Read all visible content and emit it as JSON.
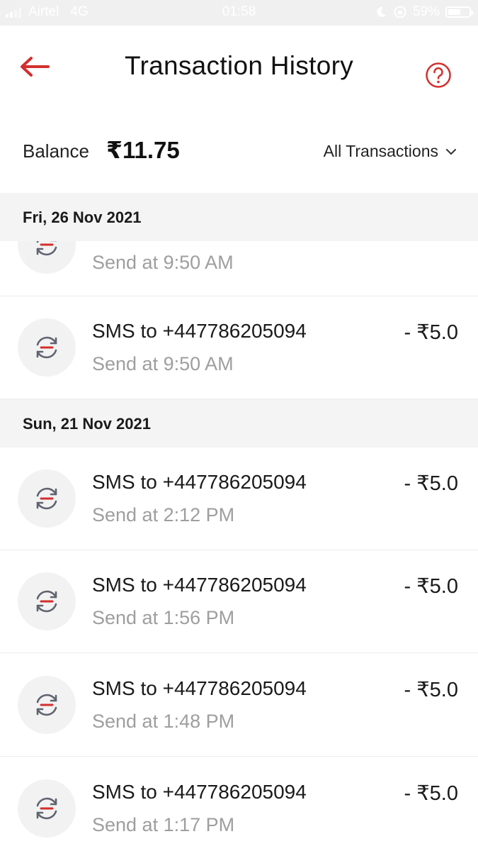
{
  "status_bar": {
    "carrier": "Airtel",
    "network": "4G",
    "time": "01:58",
    "battery_percent": "59%",
    "battery_level": 0.59,
    "icons": [
      "moon-icon",
      "orientation-lock-icon"
    ]
  },
  "header": {
    "title": "Transaction History",
    "back_icon": "arrow-left-icon",
    "help_icon": "question-circle-icon",
    "accent_color": "#d32f2f"
  },
  "balance": {
    "label": "Balance",
    "value": "₹11.75"
  },
  "filter": {
    "label": "All Transactions",
    "icon": "chevron-down-icon"
  },
  "groups": [
    {
      "date": "Fri, 26 Nov 2021",
      "transactions": [
        {
          "title": "",
          "subtitle": "Send at 9:50 AM",
          "amount": ""
        },
        {
          "title": "SMS to +447786205094",
          "subtitle": "Send at 9:50 AM",
          "amount": "- ₹5.0"
        }
      ]
    },
    {
      "date": "Sun, 21 Nov 2021",
      "transactions": [
        {
          "title": "SMS to +447786205094",
          "subtitle": "Send at 2:12 PM",
          "amount": "- ₹5.0"
        },
        {
          "title": "SMS to +447786205094",
          "subtitle": "Send at 1:56 PM",
          "amount": "- ₹5.0"
        },
        {
          "title": "SMS to +447786205094",
          "subtitle": "Send at 1:48 PM",
          "amount": "- ₹5.0"
        },
        {
          "title": "SMS to +447786205094",
          "subtitle": "Send at 1:17 PM",
          "amount": "- ₹5.0"
        }
      ]
    }
  ]
}
